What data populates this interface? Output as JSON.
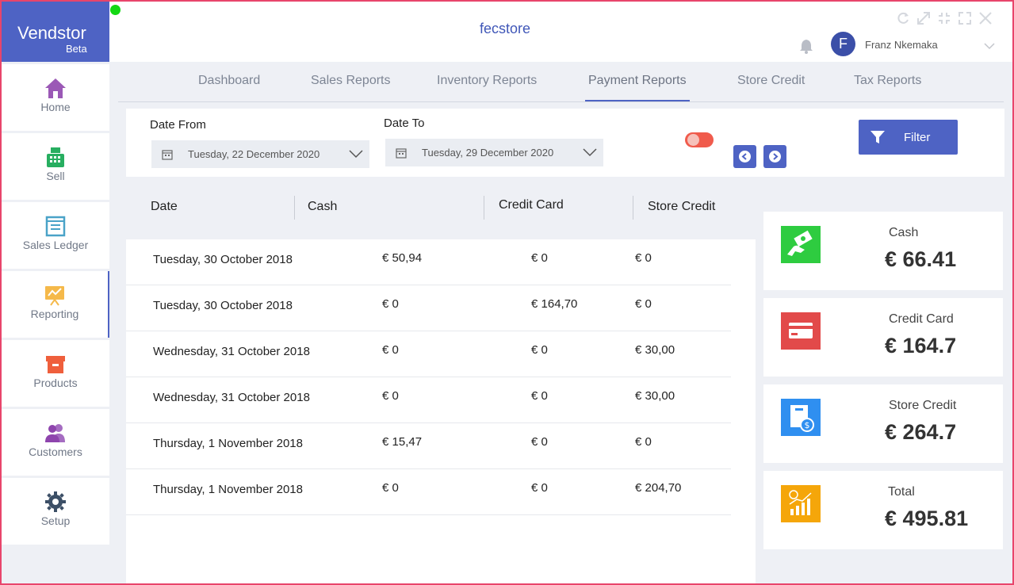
{
  "app": {
    "brand": "Vendstor",
    "brand_sub": "Beta",
    "store_name": "fecstore",
    "user_initial": "F",
    "user_name": "Franz Nkemaka"
  },
  "sidebar": {
    "items": [
      {
        "label": "Home",
        "icon": "home-icon"
      },
      {
        "label": "Sell",
        "icon": "cash-register-icon"
      },
      {
        "label": "Sales Ledger",
        "icon": "ledger-icon"
      },
      {
        "label": "Reporting",
        "icon": "chart-icon",
        "active": true
      },
      {
        "label": "Products",
        "icon": "box-icon"
      },
      {
        "label": "Customers",
        "icon": "users-icon"
      },
      {
        "label": "Setup",
        "icon": "gear-icon"
      }
    ]
  },
  "tabs": [
    {
      "label": "Dashboard"
    },
    {
      "label": "Sales Reports"
    },
    {
      "label": "Inventory Reports"
    },
    {
      "label": "Payment Reports",
      "active": true
    },
    {
      "label": "Store Credit"
    },
    {
      "label": "Tax Reports"
    }
  ],
  "filters": {
    "date_from_label": "Date From",
    "date_from_value": "Tuesday, 22 December 2020",
    "date_to_label": "Date To",
    "date_to_value": "Tuesday, 29 December 2020",
    "filter_button": "Filter"
  },
  "table": {
    "headers": [
      "Date",
      "Cash",
      "Credit Card",
      "Store Credit"
    ],
    "rows": [
      [
        "Tuesday, 30 October 2018",
        "€ 50,94",
        "€ 0",
        "€ 0"
      ],
      [
        "Tuesday, 30 October 2018",
        "€ 0",
        "€ 164,70",
        "€ 0"
      ],
      [
        "Wednesday, 31 October 2018",
        "€ 0",
        "€ 0",
        "€ 30,00"
      ],
      [
        "Wednesday, 31 October 2018",
        "€ 0",
        "€ 0",
        "€ 30,00"
      ],
      [
        "Thursday, 1 November 2018",
        "€ 15,47",
        "€ 0",
        "€ 0"
      ],
      [
        "Thursday, 1 November 2018",
        "€ 0",
        "€ 0",
        "€ 204,70"
      ]
    ]
  },
  "summary": [
    {
      "title": "Cash",
      "value": "€ 66.41",
      "color": "#2ecc40",
      "icon": "cash-hand-icon"
    },
    {
      "title": "Credit Card",
      "value": "€ 164.7",
      "color": "#e24a4a",
      "icon": "credit-card-icon"
    },
    {
      "title": "Store Credit",
      "value": "€ 264.7",
      "color": "#2f8ff0",
      "icon": "store-credit-icon"
    },
    {
      "title": "Total",
      "value": "€ 495.81",
      "color": "#f5a60a",
      "icon": "growth-chart-icon"
    }
  ],
  "colors": {
    "accent": "#4e63c4",
    "frame": "#e8456b",
    "toggle": "#f05b4c"
  }
}
